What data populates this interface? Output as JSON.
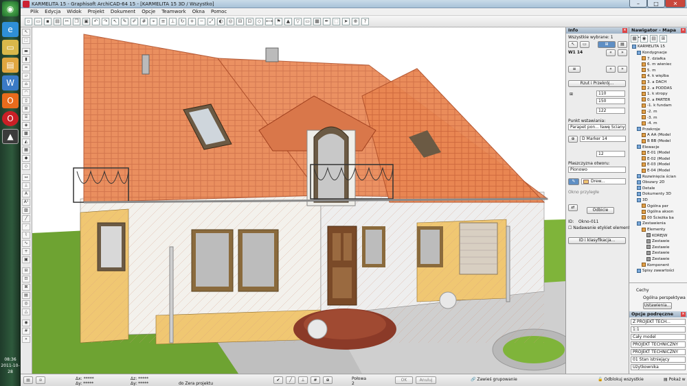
{
  "window": {
    "title": "KARMELITA 15 - Graphisoft ArchiCAD-64 15 - [KARMELITA 15 3D / Wszystko]"
  },
  "menu": [
    "Plik",
    "Edycja",
    "Widok",
    "Projekt",
    "Dokument",
    "Opcje",
    "Teamwork",
    "Okna",
    "Pomoc"
  ],
  "taskbar": {
    "time": "08:36",
    "date": "2011-10-28"
  },
  "info_palette": {
    "title": "Info",
    "selection": "Wszystkie wybrane: 1",
    "element_id": "W1 14",
    "view_button": "Rzut i Przekrój...",
    "width_value": "110",
    "height_value": "150",
    "sill_value": "122",
    "anchor_label": "Punkt wstawiania:",
    "anchor_value": "Parapet pon... ławę Ściany",
    "marker_value": "D Marker 14",
    "marker_num": "12",
    "opening_label": "Płaszczyzna otworu:",
    "opening_value": "Pionowo",
    "material_value": "Drew...",
    "mirror_label": "Okno przyległe",
    "mirror_button": "Odbicie",
    "id_label": "ID:",
    "id_value": "Okno-011",
    "auto_label": "Nadawanie etykiet element.",
    "classify_button": "ID i klasyfikacja..."
  },
  "navigator": {
    "title": "Nawigator - Mapa pr...",
    "project": "KARMELITA 15",
    "items": [
      "Kondygnacje",
      "7. działka",
      "6. m wieniec",
      "5. m",
      "4. k więźba",
      "3. a DACH",
      "2. a PODDAS",
      "1. k stropy",
      "0. a PARTER",
      "-1. k fundam",
      "-2. m",
      "-3. m",
      "-4. m",
      "Przekroje",
      "A AA (Model",
      "B BB (Model",
      "Elewacje",
      "E-01 (Model",
      "E-02 (Model",
      "E-03 (Model",
      "E-04 (Model",
      "Rozwinięcia ścian",
      "Obszary 2D",
      "Detale",
      "Dokumenty 3D",
      "3D",
      "Ogólna per",
      "Ogólna akson",
      "00 Ścieżka ba",
      "Zestawienia",
      "Elementy",
      "KOREJW",
      "Zestawie",
      "Zestawie",
      "Zestawie",
      "Zestawie",
      "Komponent",
      "Spisy zawartości"
    ],
    "info_label": "Cechy",
    "persp_label": "Ogólna perspektywa",
    "settings_button": "Ustawienia..."
  },
  "publisher": {
    "title": "Opcje podręczne",
    "rows": [
      "Z    PROJEKT TECH...",
      "1:1",
      "Cały model",
      "PROJEKT TECHNICZNY",
      "PROJEKT TECHNICZNY",
      "01 Stan istniejący",
      "Użytkownika"
    ]
  },
  "status": {
    "dx_label": "Δx: *****",
    "dy_label": "Δy: *****",
    "ax_label": "Δz: *****",
    "ay_label": "Δy: *****",
    "zero_label": "do Zera projektu",
    "half_label": "Połowa",
    "half_num": "2",
    "ok_button": "OK",
    "cancel_button": "Anuluj",
    "group_button": "Zawieś grupowanie",
    "unlock_button": "Odblokuj wszystkie",
    "show_button": "Pokaż w"
  },
  "colors": {
    "roof": "#e77a45",
    "wall_warm": "#f0c772",
    "grass": "#7fb43a",
    "panel_header": "#a8bccf"
  }
}
